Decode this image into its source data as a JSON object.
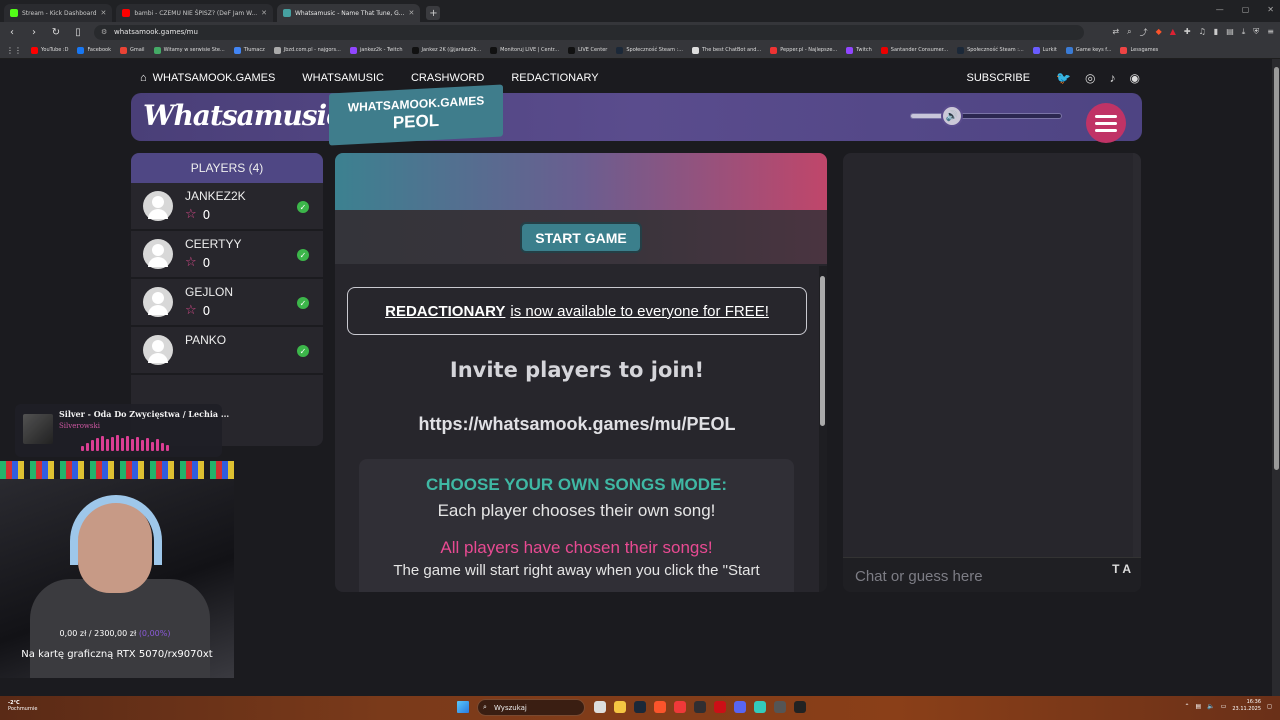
{
  "browser": {
    "tabs": [
      {
        "title": "Stream - Kick Dashboard",
        "color": "#53fc18"
      },
      {
        "title": "bambi - CZEMU NIE ŚPISZ? (DeF Jam W...",
        "color": "#ff0000"
      },
      {
        "title": "Whatsamusic - Name That Tune, G...",
        "color": "#46a1a1",
        "active": true
      }
    ],
    "address": "whatsamook.games/mu",
    "bookmarks": [
      "YouTube :D",
      "Facebook",
      "Gmail",
      "Witamy w serwisie Ste...",
      "Tłumacz",
      "Jbzd.com.pl - najgors...",
      "jankez2k - Twitch",
      "Jankez 2K (@jankez2k...",
      "Monitoruj LIVE | Centr...",
      "LIVE Center",
      "Społeczność Steam :...",
      "The best ChatBot and...",
      "Pepper.pl - Najlepsze...",
      "Twitch",
      "Santander Consumer...",
      "Społeczność Steam :...",
      "Lurkit",
      "Game keys f...",
      "Lessgames"
    ]
  },
  "nav": {
    "home": "WHATSAMOOK.GAMES",
    "links": [
      "WHATSAMUSIC",
      "CRASHWORD",
      "REDACTIONARY"
    ],
    "subscribe": "SUBSCRIBE"
  },
  "header": {
    "logo": "Whatsamusic",
    "site": "WHATSAMOOK.GAMES",
    "room": "PEOL",
    "volume": 0.2
  },
  "players": {
    "title": "PLAYERS (4)",
    "list": [
      {
        "name": "JANKEZ2K",
        "score": "0"
      },
      {
        "name": "CEERTYY",
        "score": "0"
      },
      {
        "name": "GEJLON",
        "score": "0"
      },
      {
        "name": "PANKO",
        "score": ""
      }
    ]
  },
  "game": {
    "start_label": "START GAME",
    "promo_bold": "REDACTIONARY",
    "promo_rest": "is now available to everyone for FREE!",
    "invite_title": "Invite players to join!",
    "invite_url": "https://whatsamook.games/mu/PEOL",
    "mode_title": "CHOOSE YOUR OWN SONGS MODE:",
    "mode_desc": "Each player chooses their own song!",
    "chosen": "All players have chosen their songs!",
    "start_note": "The game will start right away when you click the \"Start"
  },
  "chat": {
    "placeholder": "Chat or guess here",
    "ta_label": "T A"
  },
  "overlay": {
    "song_title": "Silver - Oda Do Zwycięstwa / Lechia ...",
    "song_artist": "Silverowski",
    "donation_current": "0,00 zł",
    "donation_sep": "/",
    "donation_goal": "2300,00 zł",
    "donation_pct": "(0,00%)",
    "goal_text": "Na kartę graficzną RTX 5070/rx9070xt"
  },
  "taskbar": {
    "weather_temp": "-2°C",
    "weather_desc": "Pochmurnie",
    "search_label": "Wyszukaj",
    "time": "16:36",
    "date": "23.11.2025"
  }
}
